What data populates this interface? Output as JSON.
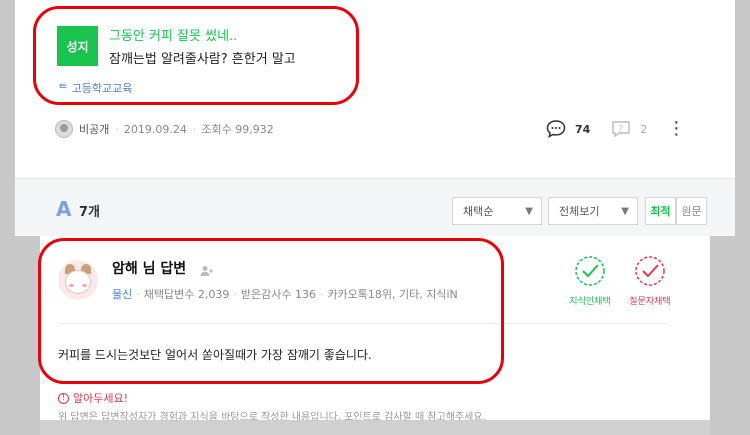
{
  "question": {
    "badge": "성지",
    "title": "그동안 커피 잘못 썼네..",
    "body": "잠깨는법 알려줄사람? 흔한거 말고",
    "tag": "ᄐ 고등학교교육",
    "author": "비공개",
    "date": "2019.09.24",
    "views": "조회수 99,932",
    "comment_count": "74",
    "reply_count": "2"
  },
  "answers_header": {
    "glyph": "A",
    "count": "7개",
    "sort_select": "채택순",
    "filter_select": "전체보기",
    "toggle_latest": "최적",
    "toggle_original": "원문"
  },
  "answer": {
    "author": "암해 님 답변",
    "level": "물신",
    "adopted": "채택답변수 2,039",
    "thanks": "받은감사수 136",
    "rank": "카카오톡18위, 기타, 지식iN",
    "badge_knowledge": "지식인채택",
    "badge_asker": "질문자채택",
    "body": "커피를 드시는것보단 얼어서 쏟아질때가 가장 잠깨기 좋습니다.",
    "notice_title": "알아두세요!",
    "notice_body": "위 답변은 답변작성자가 경험과 지식을 바탕으로 작성한 내용입니다. 포인트로 감사할 때 참고해주세요."
  },
  "colors": {
    "brand_green": "#19c34e",
    "highlight_red": "#e8000b",
    "link_blue": "#4a7fd6",
    "alert_red": "#e8384a"
  }
}
